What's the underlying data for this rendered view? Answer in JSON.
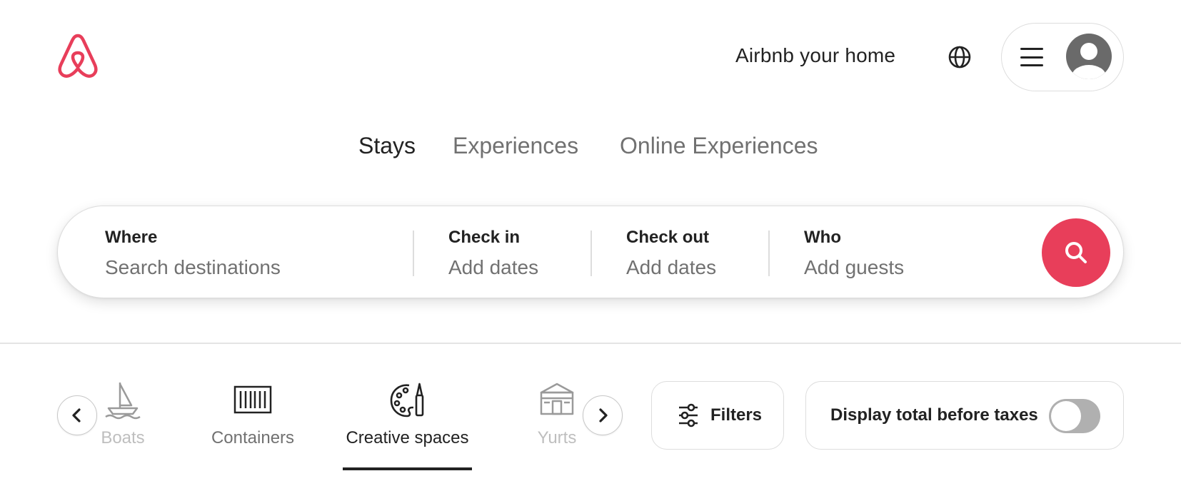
{
  "header": {
    "logo_icon": "airbnb-logo-icon",
    "host_link": "Airbnb your home",
    "globe_icon": "globe-icon",
    "menu_icon": "hamburger-menu-icon",
    "avatar_icon": "user-avatar-icon"
  },
  "tabs": [
    {
      "label": "Stays",
      "active": true
    },
    {
      "label": "Experiences",
      "active": false
    },
    {
      "label": "Online Experiences",
      "active": false
    }
  ],
  "search": {
    "where_label": "Where",
    "where_placeholder": "Search destinations",
    "checkin_label": "Check in",
    "checkin_placeholder": "Add dates",
    "checkout_label": "Check out",
    "checkout_placeholder": "Add dates",
    "who_label": "Who",
    "who_placeholder": "Add guests",
    "button_icon": "search-icon"
  },
  "categories": [
    {
      "label": "Boats",
      "icon": "boat-icon"
    },
    {
      "label": "Containers",
      "icon": "container-icon"
    },
    {
      "label": "Creative spaces",
      "icon": "palette-icon",
      "active": true
    },
    {
      "label": "Yurts",
      "icon": "yurt-icon"
    }
  ],
  "filters": {
    "label": "Filters",
    "icon": "sliders-icon"
  },
  "taxes": {
    "label": "Display total before taxes",
    "toggle_on": false
  },
  "colors": {
    "brand": "#e83e5a",
    "text": "#222222",
    "muted": "#717171",
    "border": "#dddddd"
  }
}
